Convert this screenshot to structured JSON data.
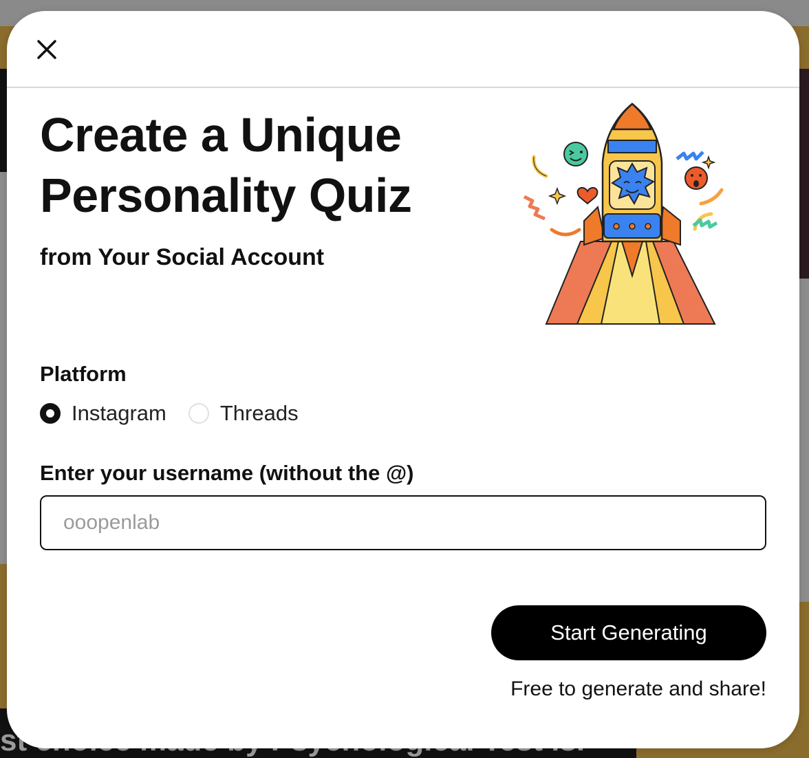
{
  "background": {
    "bottom_text": "st choice made by Psychological Test is."
  },
  "modal": {
    "title": "Create a Unique Personality Quiz",
    "subtitle": "from Your Social Account",
    "platform": {
      "label": "Platform",
      "options": [
        {
          "label": "Instagram",
          "selected": true
        },
        {
          "label": "Threads",
          "selected": false
        }
      ]
    },
    "username": {
      "label": "Enter your username (without the @)",
      "placeholder": "ooopenlab",
      "value": ""
    },
    "start_button": "Start Generating",
    "footnote": "Free to generate and share!"
  },
  "colors": {
    "accent": "#000000",
    "overlay_gold": "#8a6c2c",
    "rocket_blue": "#3a82f0",
    "rocket_orange": "#ee7a2a",
    "rocket_yellow": "#f7c64a"
  },
  "icons": [
    "close-icon",
    "rocket-illustration"
  ]
}
